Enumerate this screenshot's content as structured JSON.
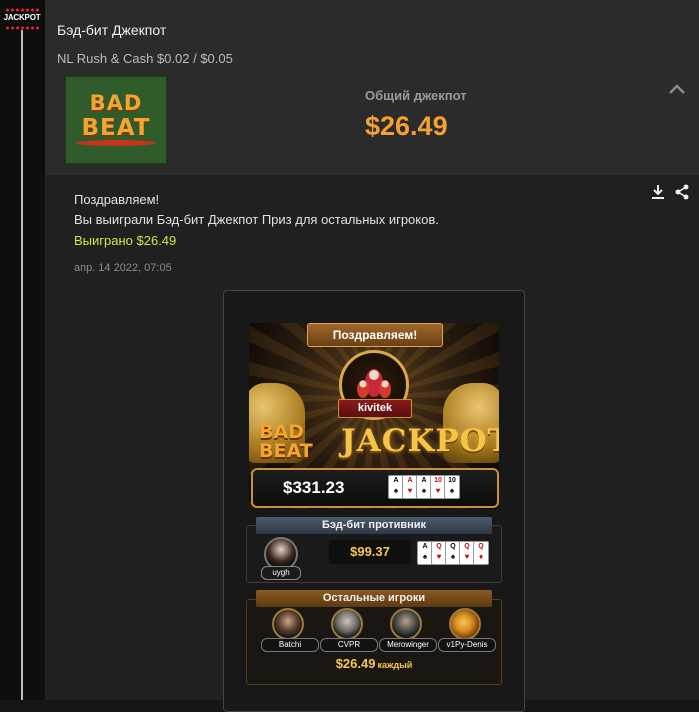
{
  "app": {
    "rail_badge": "JACKPOT"
  },
  "header": {
    "title": "Бэд-бит Джекпот",
    "subtitle": "NL Rush & Cash $0.02 / $0.05",
    "thumb_line1": "BAD",
    "thumb_line2": "BEAT",
    "jackpot_label": "Общий джекпот",
    "jackpot_amount": "$26.49"
  },
  "message": {
    "line1": "Поздравляем!",
    "line2": "Вы выиграли Бэд-бит Джекпот Приз для остальных игроков.",
    "won": "Выиграно $26.49",
    "date": "апр. 14 2022, 07:05"
  },
  "card": {
    "congrats": "Поздравляем!",
    "winner_name": "kivitek",
    "logo_line1": "BAD",
    "logo_line2": "BEAT",
    "logo_jackpot": "JACKPOT",
    "total_amount": "$331.23",
    "winner_cards": [
      {
        "rank": "A",
        "suit": "♠",
        "color": "black"
      },
      {
        "rank": "A",
        "suit": "♥",
        "color": "red"
      },
      {
        "rank": "A",
        "suit": "♠",
        "color": "black"
      },
      {
        "rank": "10",
        "suit": "♥",
        "color": "red"
      },
      {
        "rank": "10",
        "suit": "♠",
        "color": "black"
      }
    ],
    "opponent_header": "Бэд-бит противник",
    "opponent_name": "uygh",
    "opponent_amount": "$99.37",
    "opponent_cards": [
      {
        "rank": "A",
        "suit": "♠",
        "color": "black"
      },
      {
        "rank": "Q",
        "suit": "♥",
        "color": "red"
      },
      {
        "rank": "Q",
        "suit": "♠",
        "color": "black"
      },
      {
        "rank": "Q",
        "suit": "♥",
        "color": "red"
      },
      {
        "rank": "Q",
        "suit": "♦",
        "color": "red"
      }
    ],
    "others_header": "Остальные игроки",
    "others": [
      {
        "name": "Batchi"
      },
      {
        "name": "CVPR"
      },
      {
        "name": "Merowinger"
      },
      {
        "name": "v1Py-Denis"
      }
    ],
    "each_amount": "$26.49",
    "each_label": "каждый"
  },
  "colors": {
    "accent": "#f3a035",
    "won": "#d6e34a",
    "gold": "#f6c84e"
  },
  "icons": [
    "download-icon",
    "share-icon",
    "chevron-up-icon"
  ]
}
